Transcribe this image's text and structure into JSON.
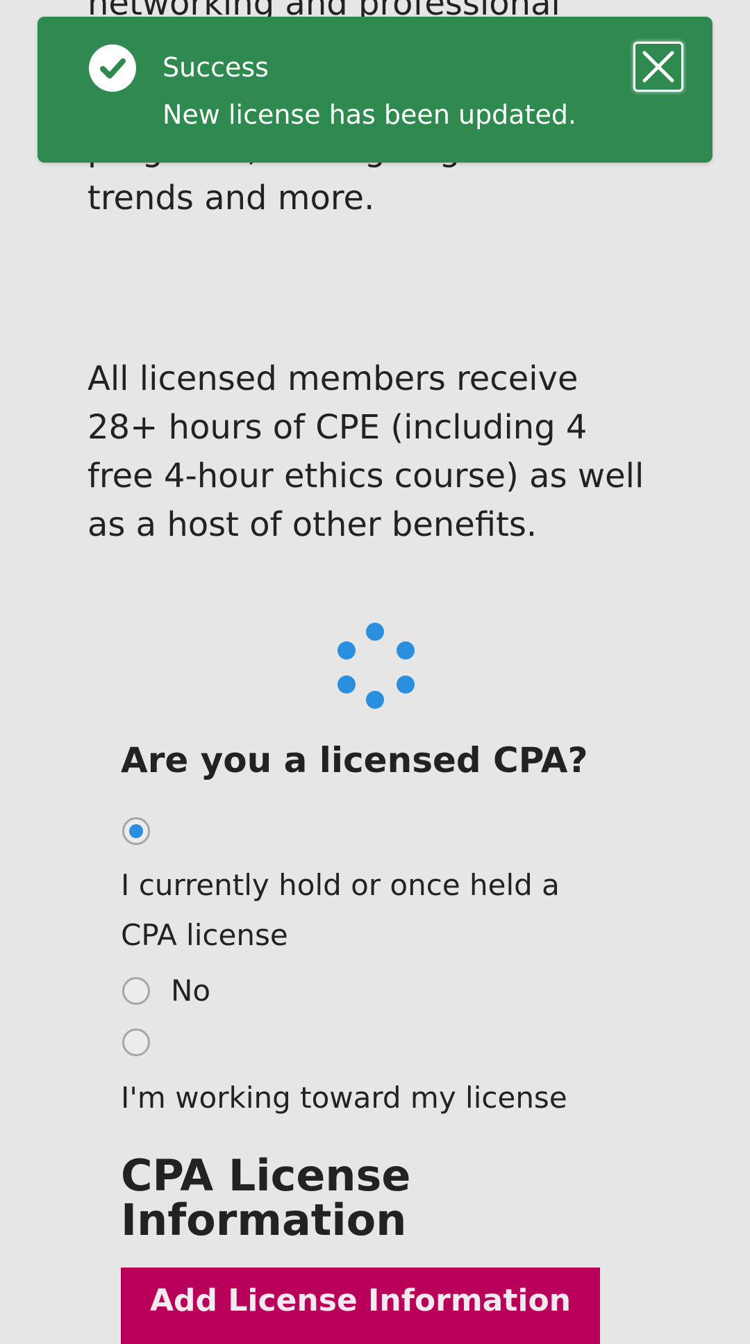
{
  "intro": {
    "paragraph_1": "networking and professional advocacy in Sacramento, leadership development programs, cutting-edge news and trends and more.",
    "paragraph_2": "All licensed members receive 28+ hours of CPE (including 4 free 4-hour ethics course) as well as a host of other benefits."
  },
  "toast": {
    "title": "Success",
    "message": "New license has been updated.",
    "icon": "check-circle-icon",
    "close_icon": "close-icon",
    "background_color": "#2f8a4f"
  },
  "spinner": {
    "icon": "loading-spinner-icon",
    "color": "#2b8fe0"
  },
  "question": {
    "heading": "Are you a licensed CPA?",
    "options": [
      {
        "label": "I currently hold or once held a CPA license",
        "selected": true
      },
      {
        "label": "No",
        "selected": false
      },
      {
        "label": "I'm working toward my license",
        "selected": false
      }
    ]
  },
  "license_section": {
    "heading": "CPA License Information",
    "add_button_label": "Add License Information",
    "button_color": "#b8005a"
  }
}
